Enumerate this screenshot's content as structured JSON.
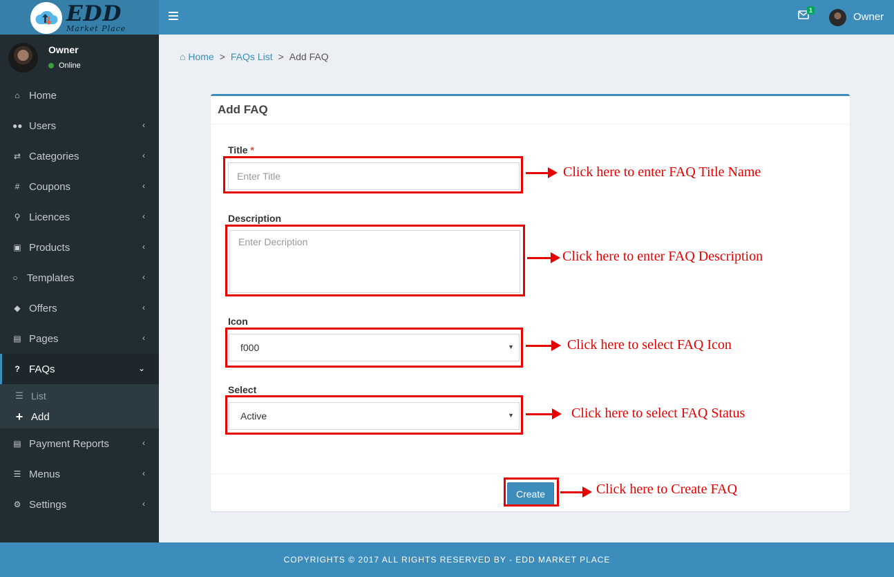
{
  "brand": {
    "name": "EDD",
    "sub": "Market Place"
  },
  "header": {
    "notification_count": "1",
    "user": "Owner"
  },
  "user_panel": {
    "name": "Owner",
    "status": "Online"
  },
  "sidebar": {
    "items": [
      {
        "label": "Home",
        "icon": "home-icon"
      },
      {
        "label": "Users",
        "icon": "users-icon"
      },
      {
        "label": "Categories",
        "icon": "random-icon"
      },
      {
        "label": "Coupons",
        "icon": "hash-icon"
      },
      {
        "label": "Licences",
        "icon": "key-icon"
      },
      {
        "label": "Products",
        "icon": "bag-icon"
      },
      {
        "label": "Templates",
        "icon": "chat-icon"
      },
      {
        "label": "Offers",
        "icon": "tags-icon"
      },
      {
        "label": "Pages",
        "icon": "file-icon"
      },
      {
        "label": "FAQs",
        "icon": "question-icon"
      },
      {
        "label": "Payment Reports",
        "icon": "file-icon"
      },
      {
        "label": "Menus",
        "icon": "bars-icon"
      },
      {
        "label": "Settings",
        "icon": "gear-icon"
      }
    ],
    "faq_sub": [
      {
        "label": "List"
      },
      {
        "label": "Add"
      }
    ]
  },
  "breadcrumb": {
    "home": "Home",
    "list": "FAQs List",
    "current": "Add FAQ"
  },
  "form": {
    "title": "Add FAQ",
    "title_label": "Title",
    "title_required": "*",
    "title_placeholder": "Enter Title",
    "description_label": "Description",
    "description_placeholder": "Enter Decription",
    "icon_label": "Icon",
    "icon_value": "f000",
    "status_label": "Select",
    "status_value": "Active",
    "create_label": "Create"
  },
  "annotations": {
    "title": "Click here to enter FAQ Title Name",
    "description": "Click here to enter FAQ Description",
    "icon": "Click here to select FAQ Icon",
    "status": "Click here to select FAQ Status",
    "create": "Click here to Create FAQ"
  },
  "footer": {
    "text": "COPYRIGHTS © 2017 ALL RIGHTS RESERVED BY - EDD MARKET PLACE"
  },
  "colors": {
    "primary": "#3c8dbc",
    "sidebar": "#222d32",
    "annotation": "#e60000"
  }
}
